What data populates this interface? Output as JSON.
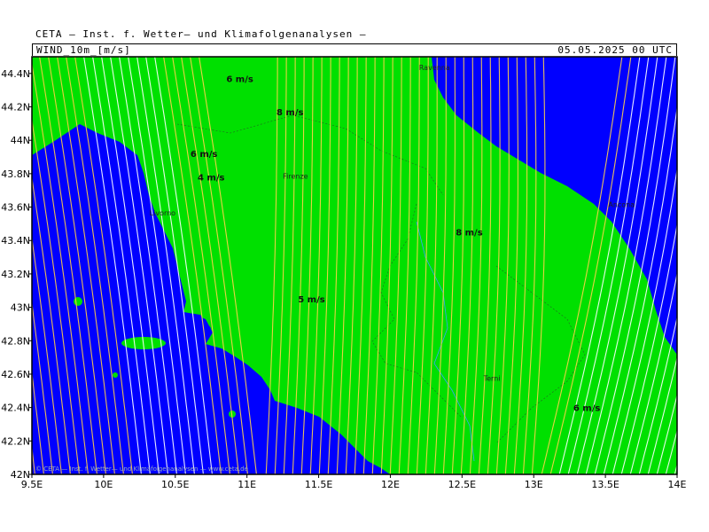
{
  "header": {
    "title": "CETA — Inst. f. Wetter— und Klimafolgenanalysen —",
    "variable": "WIND_10m_[m/s]",
    "datetime": "05.05.2025 00 UTC"
  },
  "map": {
    "lon_range": [
      9.5,
      14.0
    ],
    "lat_range": [
      42.0,
      44.5
    ],
    "lon_ticks": [
      "9.5E",
      "10E",
      "10.5E",
      "11E",
      "11.5E",
      "12E",
      "12.5E",
      "13E",
      "13.5E",
      "14E"
    ],
    "lat_ticks": [
      "42N",
      "42.2N",
      "42.4N",
      "42.6N",
      "42.8N",
      "43N",
      "43.2N",
      "43.4N",
      "43.6N",
      "43.8N",
      "44N",
      "44.2N",
      "44.4N"
    ],
    "colors": {
      "land": "#00e000",
      "sea": "#0000ff",
      "streamline_land": "#ffd24a",
      "streamline_strong": "#ffffff",
      "streamline_sea": "#ffcc44"
    },
    "cities": [
      {
        "name": "Ravenna",
        "lon": 12.2,
        "lat": 44.42
      },
      {
        "name": "Firenze",
        "lon": 11.25,
        "lat": 43.77
      },
      {
        "name": "Livorno",
        "lon": 10.32,
        "lat": 43.55
      },
      {
        "name": "Ancona",
        "lon": 13.52,
        "lat": 43.6
      },
      {
        "name": "Terni",
        "lon": 12.65,
        "lat": 42.56
      }
    ],
    "speed_labels": [
      {
        "text": "6 m/s",
        "lon": 10.95,
        "lat": 44.35
      },
      {
        "text": "8 m/s",
        "lon": 11.3,
        "lat": 44.15
      },
      {
        "text": "6 m/s",
        "lon": 10.7,
        "lat": 43.9
      },
      {
        "text": "4 m/s",
        "lon": 10.75,
        "lat": 43.76
      },
      {
        "text": "5 m/s",
        "lon": 11.45,
        "lat": 43.03
      },
      {
        "text": "8 m/s",
        "lon": 12.55,
        "lat": 43.43
      },
      {
        "text": "6 m/s",
        "lon": 13.37,
        "lat": 42.38
      }
    ],
    "footer_text": "© CETA — Inst. f. Wetter— und Klimafolgenanalysen — www.ceta.de"
  }
}
